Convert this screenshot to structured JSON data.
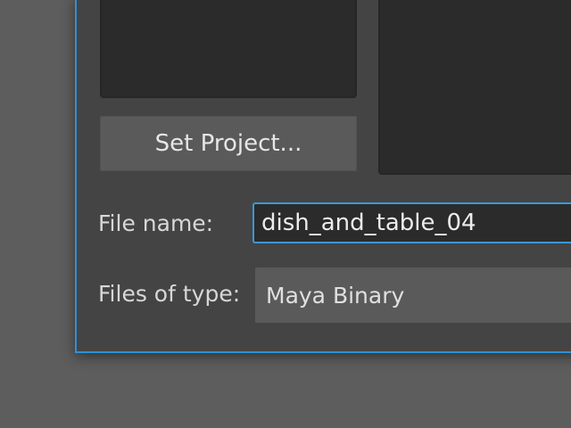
{
  "dialog": {
    "set_project_label": "Set Project...",
    "file_name_label": "File name:",
    "file_name_value": "dish_and_table_04",
    "files_of_type_label": "Files of type:",
    "files_of_type_value": "Maya Binary"
  },
  "colors": {
    "accent": "#2f8fd6",
    "dialog_bg": "#444444",
    "panel_bg": "#2b2b2b",
    "button_bg": "#5a5a5a"
  }
}
